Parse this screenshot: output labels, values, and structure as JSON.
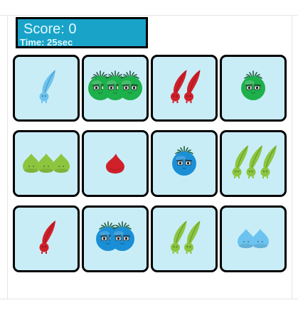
{
  "hud": {
    "score_text": "Score: 0",
    "time_text": "Time: 25sec"
  },
  "colors": {
    "card_bg": "#c9edf7",
    "hud_bg": "#1aa3c8",
    "green": "#1db04b",
    "blue": "#1a8fd6",
    "red": "#d0202a",
    "lightgreen": "#8cc63f",
    "lightblue": "#6cc3f0"
  },
  "cards": [
    {
      "shape": "sprout",
      "color": "lightblue",
      "count": 1
    },
    {
      "shape": "bulb",
      "color": "green",
      "count": 3
    },
    {
      "shape": "sprout",
      "color": "red",
      "count": 2
    },
    {
      "shape": "bulb",
      "color": "green",
      "count": 1
    },
    {
      "shape": "blob",
      "color": "lightgreen",
      "count": 3
    },
    {
      "shape": "drop",
      "color": "red",
      "count": 1
    },
    {
      "shape": "bulb",
      "color": "blue",
      "count": 1
    },
    {
      "shape": "sprout",
      "color": "lightgreen",
      "count": 3
    },
    {
      "shape": "sprout",
      "color": "red",
      "count": 1
    },
    {
      "shape": "bulb",
      "color": "blue",
      "count": 2
    },
    {
      "shape": "sprout",
      "color": "lightgreen",
      "count": 2
    },
    {
      "shape": "blob",
      "color": "lightblue",
      "count": 2
    }
  ]
}
